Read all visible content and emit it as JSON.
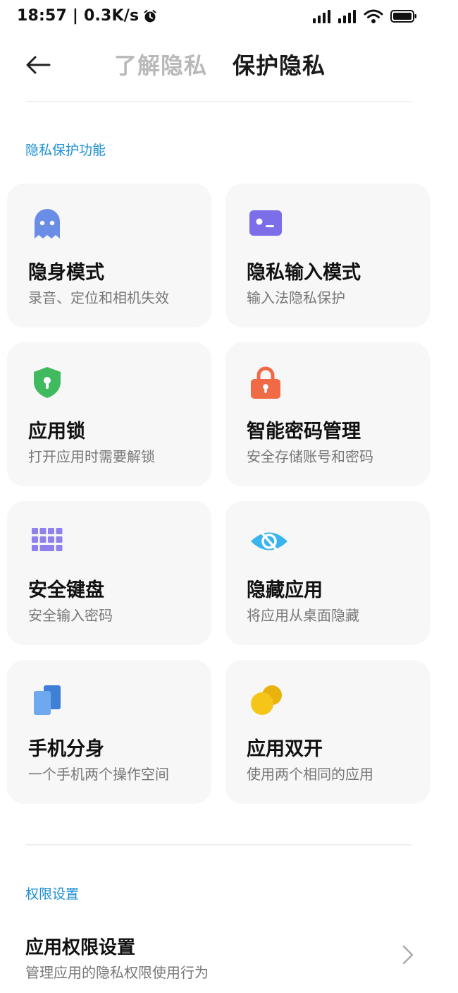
{
  "status_bar": {
    "time_speed": "18:57 | 0.3K/s",
    "icons": [
      "alarm-icon",
      "signal-icon",
      "signal-icon",
      "wifi-icon",
      "battery-icon"
    ]
  },
  "header": {
    "back_icon": "arrow-left-icon",
    "tabs": [
      {
        "label": "了解隐私",
        "active": false
      },
      {
        "label": "保护隐私",
        "active": true
      }
    ]
  },
  "sections": {
    "privacy_features": "隐私保护功能",
    "permissions": "权限设置"
  },
  "cards": [
    {
      "title": "隐身模式",
      "subtitle": "录音、定位和相机失效",
      "icon": "ghost-icon",
      "color": "#6a8ee6"
    },
    {
      "title": "隐私输入模式",
      "subtitle": "输入法隐私保护",
      "icon": "terminal-icon",
      "color": "#7b6ee8"
    },
    {
      "title": "应用锁",
      "subtitle": "打开应用时需要解锁",
      "icon": "shield-lock-icon",
      "color": "#3fba5f"
    },
    {
      "title": "智能密码管理",
      "subtitle": "安全存储账号和密码",
      "icon": "padlock-icon",
      "color": "#f06a45"
    },
    {
      "title": "安全键盘",
      "subtitle": "安全输入密码",
      "icon": "keypad-icon",
      "color": "#8f80ee"
    },
    {
      "title": "隐藏应用",
      "subtitle": "将应用从桌面隐藏",
      "icon": "eye-off-icon",
      "color": "#3ab4ee"
    },
    {
      "title": "手机分身",
      "subtitle": "一个手机两个操作空间",
      "icon": "dual-phone-icon",
      "color": "#5a98e8"
    },
    {
      "title": "应用双开",
      "subtitle": "使用两个相同的应用",
      "icon": "dual-circle-icon",
      "color": "#f5c518"
    }
  ],
  "permission_item": {
    "title": "应用权限设置",
    "subtitle": "管理应用的隐私权限使用行为",
    "icon": "chevron-right-icon"
  }
}
